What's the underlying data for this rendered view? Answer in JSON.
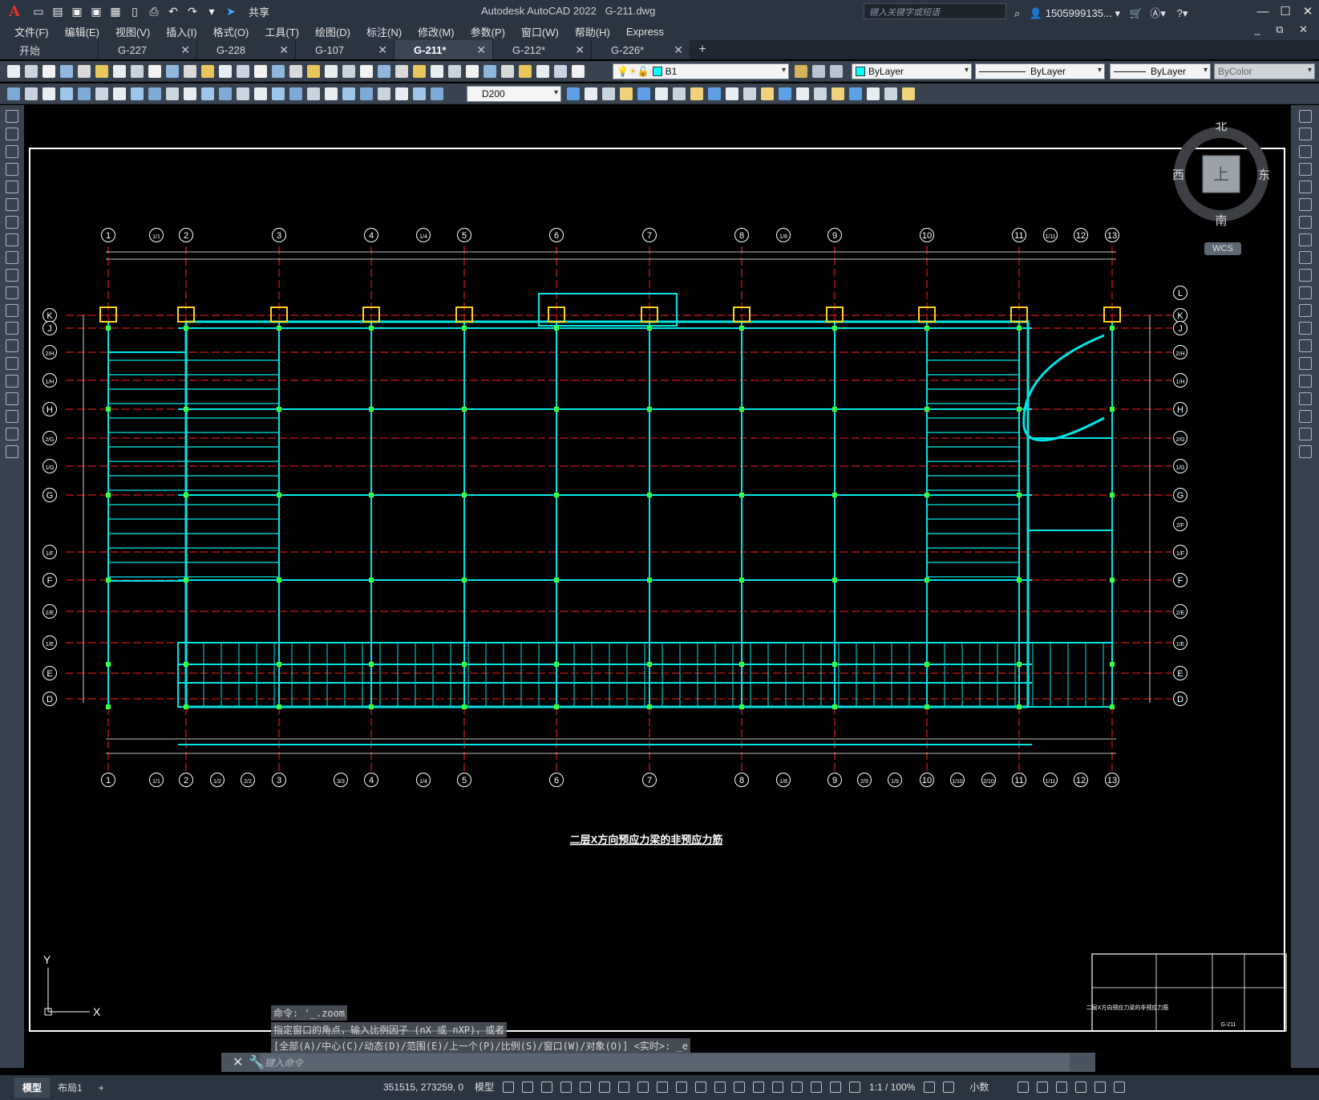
{
  "titlebar": {
    "app_title": "Autodesk AutoCAD 2022",
    "file_name": "G-211.dwg",
    "share_label": "共享",
    "search_placeholder": "键入关键字或短语",
    "user": "1505999135..."
  },
  "menu": [
    "文件(F)",
    "编辑(E)",
    "视图(V)",
    "插入(I)",
    "格式(O)",
    "工具(T)",
    "绘图(D)",
    "标注(N)",
    "修改(M)",
    "参数(P)",
    "窗口(W)",
    "帮助(H)",
    "Express"
  ],
  "tabs": [
    {
      "label": "开始",
      "closable": false,
      "active": false
    },
    {
      "label": "G-227",
      "closable": true,
      "active": false
    },
    {
      "label": "G-228",
      "closable": true,
      "active": false
    },
    {
      "label": "G-107",
      "closable": true,
      "active": false
    },
    {
      "label": "G-211*",
      "closable": true,
      "active": true
    },
    {
      "label": "G-212*",
      "closable": true,
      "active": false
    },
    {
      "label": "G-226*",
      "closable": true,
      "active": false
    }
  ],
  "properties": {
    "layer": "B1",
    "color": "ByLayer",
    "linetype": "ByLayer",
    "lineweight": "ByLayer",
    "plotstyle": "ByColor",
    "dimstyle": "D200"
  },
  "viewcube": {
    "north": "北",
    "south": "南",
    "east": "东",
    "west": "西",
    "top": "上",
    "wcs": "WCS"
  },
  "drawing": {
    "title": "二层X方向预应力梁的非预应力筋",
    "axis_top": [
      "1",
      "1/1",
      "2",
      "3",
      "4",
      "1/4",
      "5",
      "6",
      "7",
      "8",
      "1/8",
      "9",
      "10",
      "11",
      "1/11",
      "12",
      "13"
    ],
    "axis_bottom": [
      "1",
      "1/1",
      "2",
      "1/2",
      "2/2",
      "3",
      "3/3",
      "4",
      "1/4",
      "5",
      "6",
      "7",
      "8",
      "1/8",
      "9",
      "2/9",
      "1/9",
      "10",
      "1/10",
      "2/10",
      "11",
      "1/11",
      "12",
      "13"
    ],
    "axis_left": [
      "K",
      "J",
      "2/H",
      "1/H",
      "H",
      "2/G",
      "1/G",
      "G",
      "1/F",
      "F",
      "2/E",
      "1/E",
      "E",
      "D"
    ],
    "axis_right": [
      "L",
      "K",
      "J",
      "2/H",
      "1/H",
      "H",
      "2/G",
      "1/G",
      "G",
      "2/F",
      "1/F",
      "F",
      "2/E",
      "1/E",
      "E",
      "D"
    ],
    "titleblock_name": "二层X方向预应力梁的非预应力筋",
    "titleblock_number": "G-211"
  },
  "command": {
    "history": [
      "命令: '_.zoom",
      "指定窗口的角点，输入比例因子 (nX 或 nXP)，或者",
      "[全部(A)/中心(C)/动态(D)/范围(E)/上一个(P)/比例(S)/窗口(W)/对象(O)] <实时>: _e"
    ],
    "placeholder": "键入命令"
  },
  "status": {
    "layout_tabs": [
      "模型",
      "布局1"
    ],
    "coords": "351515, 273259, 0",
    "space": "模型",
    "scale": "1:1 / 100%",
    "units": "小数"
  },
  "colors": {
    "structure": "#00e5e5",
    "grid": "#ff2020",
    "node": "#3cff3c",
    "column": "#ffd21a",
    "frame": "#ffffff"
  }
}
